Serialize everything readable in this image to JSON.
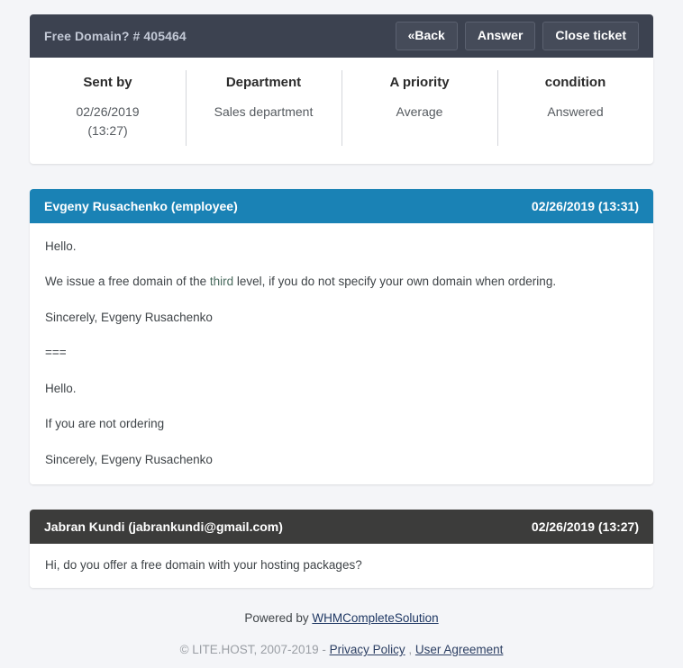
{
  "ticket": {
    "title": "Free Domain? # 405464",
    "actions": [
      {
        "name": "back",
        "label": "«Back"
      },
      {
        "name": "answer",
        "label": "Answer"
      },
      {
        "name": "close-ticket",
        "label": "Close ticket"
      }
    ],
    "info": [
      {
        "name": "sent-by",
        "label": "Sent by",
        "value": "02/26/2019\n(13:27)"
      },
      {
        "name": "department",
        "label": "Department",
        "value": "Sales department"
      },
      {
        "name": "priority",
        "label": "A priority",
        "value": "Average"
      },
      {
        "name": "condition",
        "label": "condition",
        "value": "Answered"
      }
    ]
  },
  "messages": [
    {
      "name": "message-staff",
      "author": "Evgeny Rusachenko (employee)",
      "timestamp": "02/26/2019 (13:31)",
      "style": "staff",
      "paragraphs": [
        {
          "text": "Hello."
        },
        {
          "pre": "We issue a free domain of the ",
          "highlight": "third",
          "post": " level, if you do not specify your own domain when ordering."
        },
        {
          "text": "Sincerely, Evgeny Rusachenko"
        },
        {
          "text": "==="
        },
        {
          "text": "Hello."
        },
        {
          "text": "If you are not ordering"
        },
        {
          "text": "Sincerely, Evgeny Rusachenko"
        }
      ]
    },
    {
      "name": "message-client",
      "author": "Jabran Kundi (jabrankundi@gmail.com)",
      "timestamp": "02/26/2019 (13:27)",
      "style": "client",
      "paragraphs": [
        {
          "text": "Hi, do you offer a free domain with your hosting packages?"
        }
      ]
    }
  ],
  "footer": {
    "powered_prefix": "Powered by ",
    "powered_link": "WHMCompleteSolution",
    "copyright_text": "© LITE.HOST, 2007-2019 - ",
    "privacy_link": "Privacy Policy",
    "separator": " , ",
    "agreement_link": "User Agreement"
  },
  "colors": {
    "page_background": "#f4f5f8",
    "header_dark": "#3c4250",
    "staff_blue": "#1a82b5",
    "client_dark": "#3c3c3b",
    "link": "#1f3864",
    "highlight_third": "#4a6b5e"
  }
}
